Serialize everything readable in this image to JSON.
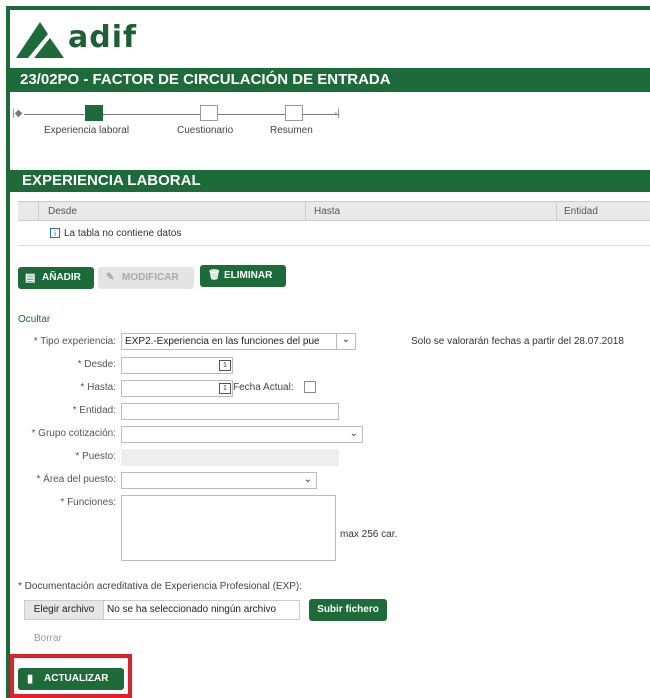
{
  "brand": {
    "name": "adif"
  },
  "header": {
    "title": "23/02PO - FACTOR DE CIRCULACIÓN DE ENTRADA"
  },
  "steps": [
    {
      "label": "Experiencia laboral",
      "active": true
    },
    {
      "label": "Cuestionario",
      "active": false
    },
    {
      "label": "Resumen",
      "active": false
    }
  ],
  "section": {
    "title": "EXPERIENCIA LABORAL"
  },
  "table": {
    "columns": [
      "Desde",
      "Hasta",
      "Entidad"
    ],
    "empty_message": "La tabla no contiene datos"
  },
  "actions": {
    "add": "AÑADIR",
    "modify": "MODIFICAR",
    "delete": "ELIMINAR"
  },
  "form": {
    "hide_link": "Ocultar",
    "tipo_label": "* Tipo experiencia:",
    "tipo_value": "EXP2.-Experiencia en las funciones del pue",
    "note": "Solo se valorarán fechas a partir del 28.07.2018",
    "desde_label": "* Desde:",
    "hasta_label": "* Hasta:",
    "fecha_actual_label": "Fecha Actual:",
    "entidad_label": "* Entidad:",
    "grupo_label": "* Grupo cotización:",
    "puesto_label": "* Puesto:",
    "area_label": "* Área del puesto:",
    "funciones_label": "* Funciones:",
    "max_chars": "max 256 car.",
    "doc_label": "* Documentación acreditativa de Experiencia Profesional (EXP):",
    "choose_file": "Elegir archivo",
    "no_file": "No se ha seleccionado ningún archivo",
    "upload": "Subir fichero",
    "clear": "Borrar",
    "update": "ACTUALIZAR"
  },
  "colors": {
    "brand_green": "#1e6b3a",
    "highlight_red": "#e0212b"
  }
}
